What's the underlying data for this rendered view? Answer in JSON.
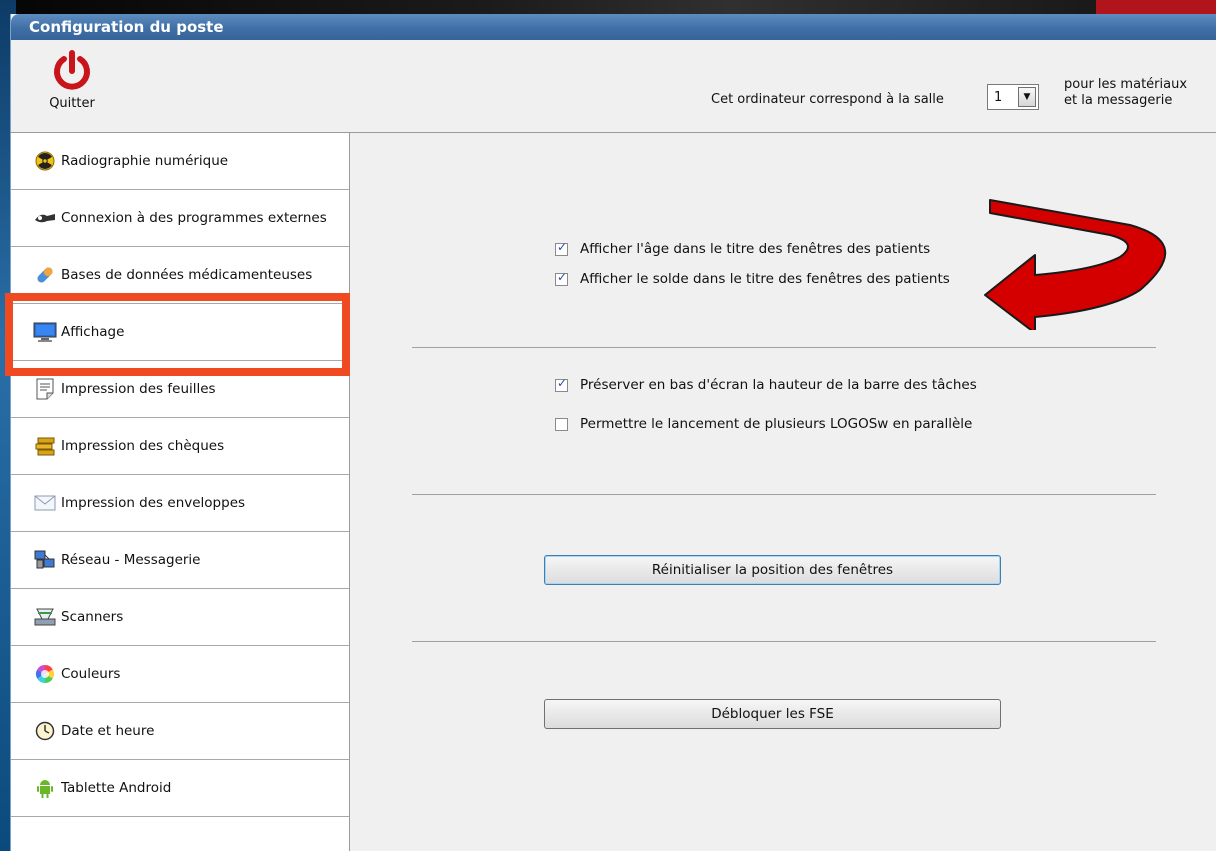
{
  "window": {
    "title": "Configuration du poste"
  },
  "toolbar": {
    "quit_label": "Quitter",
    "room_label": "Cet ordinateur correspond à la salle",
    "room_value": "1",
    "room_suffix_line1": "pour les matériaux",
    "room_suffix_line2": "et la messagerie"
  },
  "sidebar": {
    "selected": "Affichage",
    "items": [
      {
        "label": "Radiographie numérique",
        "icon": "radiation-icon"
      },
      {
        "label": "Connexion à des programmes externes",
        "icon": "plug-icon"
      },
      {
        "label": "Bases de données médicamenteuses",
        "icon": "pill-icon"
      },
      {
        "label": "Affichage",
        "icon": "monitor-icon"
      },
      {
        "label": "Impression des feuilles",
        "icon": "document-icon"
      },
      {
        "label": "Impression des chèques",
        "icon": "cheque-icon"
      },
      {
        "label": "Impression des enveloppes",
        "icon": "envelope-icon"
      },
      {
        "label": "Réseau - Messagerie",
        "icon": "network-icon"
      },
      {
        "label": "Scanners",
        "icon": "scanner-icon"
      },
      {
        "label": "Couleurs",
        "icon": "color-wheel-icon"
      },
      {
        "label": "Date et heure",
        "icon": "clock-icon"
      },
      {
        "label": "Tablette Android",
        "icon": "android-icon"
      }
    ]
  },
  "content": {
    "cb_age": {
      "label": "Afficher l'âge dans le titre des fenêtres des patients",
      "checked": true
    },
    "cb_solde": {
      "label": "Afficher le solde dans le titre des fenêtres des patients",
      "checked": true
    },
    "cb_taskbar": {
      "label": "Préserver en bas d'écran la hauteur de la barre des tâches",
      "checked": true
    },
    "cb_multi": {
      "label": "Permettre le lancement de plusieurs LOGOSw en parallèle",
      "checked": false
    },
    "btn_reset": "Réinitialiser la position des fenêtres",
    "btn_fse": "Débloquer les FSE"
  },
  "colors": {
    "titlebar": "#3f6fa6",
    "highlight_box": "#f04a23",
    "annotation_arrow": "#d40000"
  }
}
